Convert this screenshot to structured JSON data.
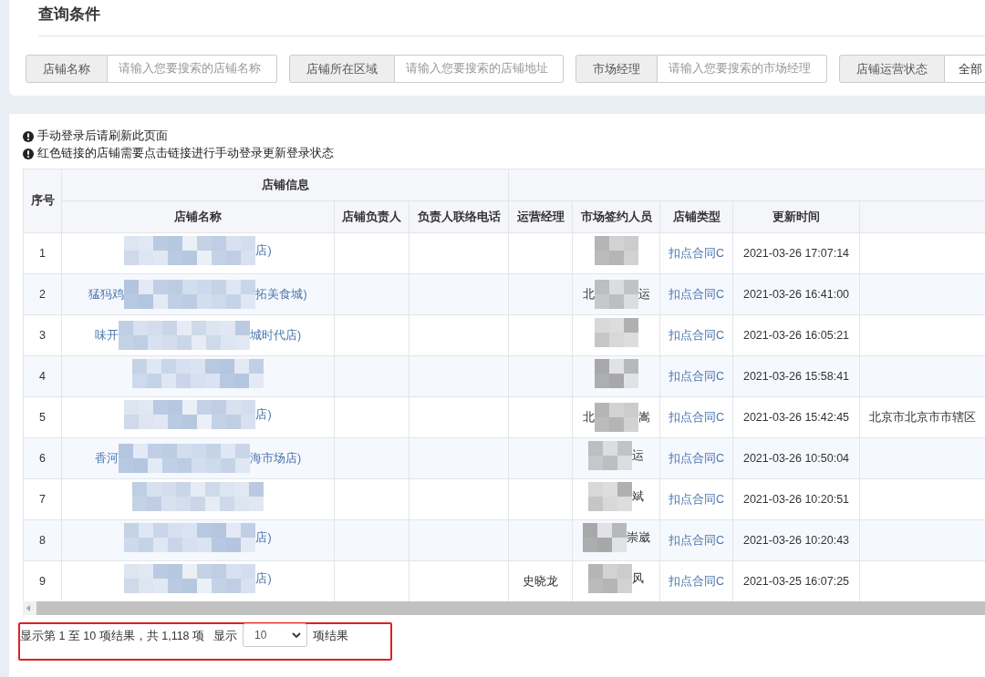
{
  "query_panel": {
    "title": "查询条件",
    "filters": [
      {
        "kind": "text",
        "label": "店铺名称",
        "placeholder": "请输入您要搜索的店铺名称"
      },
      {
        "kind": "text",
        "label": "店铺所在区域",
        "placeholder": "请输入您要搜索的店铺地址"
      },
      {
        "kind": "text",
        "label": "市场经理",
        "placeholder": "请输入您要搜索的市场经理"
      },
      {
        "kind": "select",
        "label": "店铺运营状态",
        "value": "全部"
      }
    ]
  },
  "notes": [
    "手动登录后请刷新此页面",
    "红色链接的店铺需要点击链接进行手动登录更新登录状态"
  ],
  "table": {
    "index_header": "序号",
    "groups": [
      {
        "label": "店铺信息",
        "columns": [
          {
            "label": "店铺名称"
          },
          {
            "label": "店铺负责人"
          },
          {
            "label": "负责人联络电话"
          }
        ]
      },
      {
        "columns": [
          {
            "label": "运营经理"
          },
          {
            "label": "市场签约人员"
          },
          {
            "label": "店铺类型"
          },
          {
            "label": "更新时间"
          },
          {}
        ]
      }
    ],
    "rows": [
      {
        "index": "1",
        "store_name": {
          "redacted": true,
          "end": "店)"
        },
        "signer": {
          "redacted": true
        },
        "store_type": "扣点合同C",
        "updated": "2021-03-26 17:07:14"
      },
      {
        "index": "2",
        "store_name": {
          "redacted": true,
          "start": "猛犸鸡",
          "end": "拓美食城)"
        },
        "signer": {
          "redacted": true,
          "start": "北",
          "end": "运"
        },
        "store_type": "扣点合同C",
        "updated": "2021-03-26 16:41:00"
      },
      {
        "index": "3",
        "store_name": {
          "redacted": true,
          "start": "味开",
          "end": "城时代店)"
        },
        "signer": {
          "redacted": true
        },
        "store_type": "扣点合同C",
        "updated": "2021-03-26 16:05:21"
      },
      {
        "index": "4",
        "store_name": {
          "redacted": true
        },
        "signer": {
          "redacted": true
        },
        "store_type": "扣点合同C",
        "updated": "2021-03-26 15:58:41"
      },
      {
        "index": "5",
        "store_name": {
          "redacted": true,
          "end": "店)"
        },
        "signer": {
          "redacted": true,
          "start": "北",
          "end": "嵩"
        },
        "store_type": "扣点合同C",
        "updated": "2021-03-26 15:42:45",
        "column_9": "北京市北京市市辖区"
      },
      {
        "index": "6",
        "store_name": {
          "redacted": true,
          "start": "香河",
          "end": "海市场店)"
        },
        "signer": {
          "redacted": true,
          "end": "运"
        },
        "store_type": "扣点合同C",
        "updated": "2021-03-26 10:50:04"
      },
      {
        "index": "7",
        "store_name": {
          "redacted": true
        },
        "signer": {
          "redacted": true,
          "end": "斌"
        },
        "store_type": "扣点合同C",
        "updated": "2021-03-26 10:20:51"
      },
      {
        "index": "8",
        "store_name": {
          "redacted": true,
          "end": "店)"
        },
        "signer": {
          "redacted": true,
          "end": "崇崴"
        },
        "store_type": "扣点合同C",
        "updated": "2021-03-26 10:20:43"
      },
      {
        "index": "9",
        "store_name": {
          "redacted": true,
          "end": "店)"
        },
        "ops_manager": "史晓龙",
        "signer": {
          "redacted": true,
          "end": "风"
        },
        "store_type": "扣点合同C",
        "updated": "2021-03-25 16:07:25"
      }
    ]
  },
  "pagination": {
    "summary": "显示第 1 至 10 项结果，共 1,118 项",
    "show_label": "显示",
    "page_size": "10",
    "suffix": "项结果",
    "highlighted": true
  }
}
